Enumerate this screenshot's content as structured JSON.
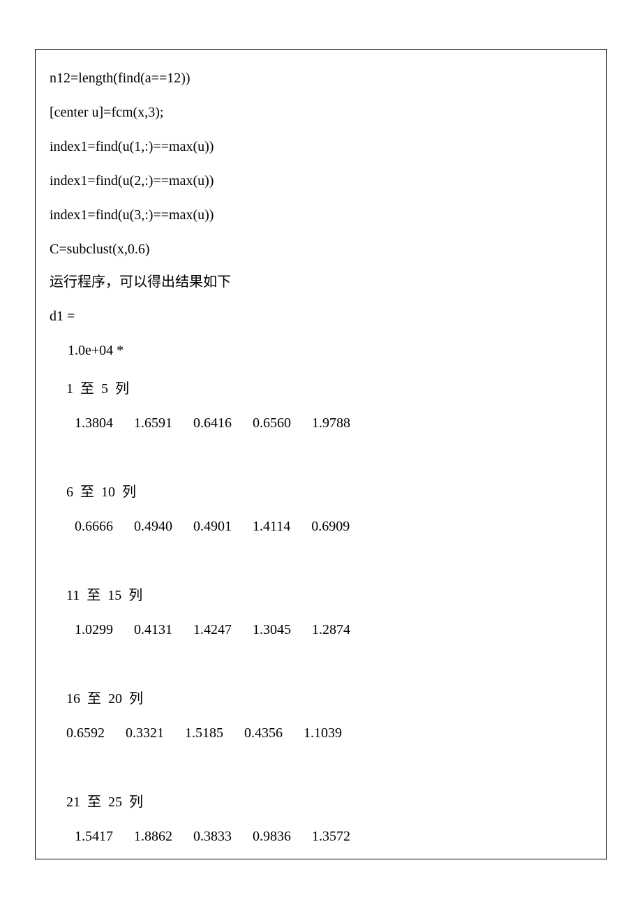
{
  "lines": {
    "l1": "n12=length(find(a==12))",
    "l2": "[center u]=fcm(x,3);",
    "l3": "index1=find(u(1,:)==max(u))",
    "l4": "index1=find(u(2,:)==max(u))",
    "l5": "index1=find(u(3,:)==max(u))",
    "l6": "C=subclust(x,0.6)",
    "l7": "运行程序，可以得出结果如下",
    "l8": "d1 =",
    "l9": "1.0e+04 *",
    "l10": "1  至  5  列",
    "l11": "1.3804      1.6591      0.6416      0.6560      1.9788",
    "l12": "6  至  10  列",
    "l13": "0.6666      0.4940      0.4901      1.4114      0.6909",
    "l14": "11  至  15  列",
    "l15": "1.0299      0.4131      1.4247      1.3045      1.2874",
    "l16": "16  至  20  列",
    "l17": "0.6592      0.3321      1.5185      0.4356      1.1039",
    "l18": "21  至  25  列",
    "l19": "1.5417      1.8862      0.3833      0.9836      1.3572"
  }
}
